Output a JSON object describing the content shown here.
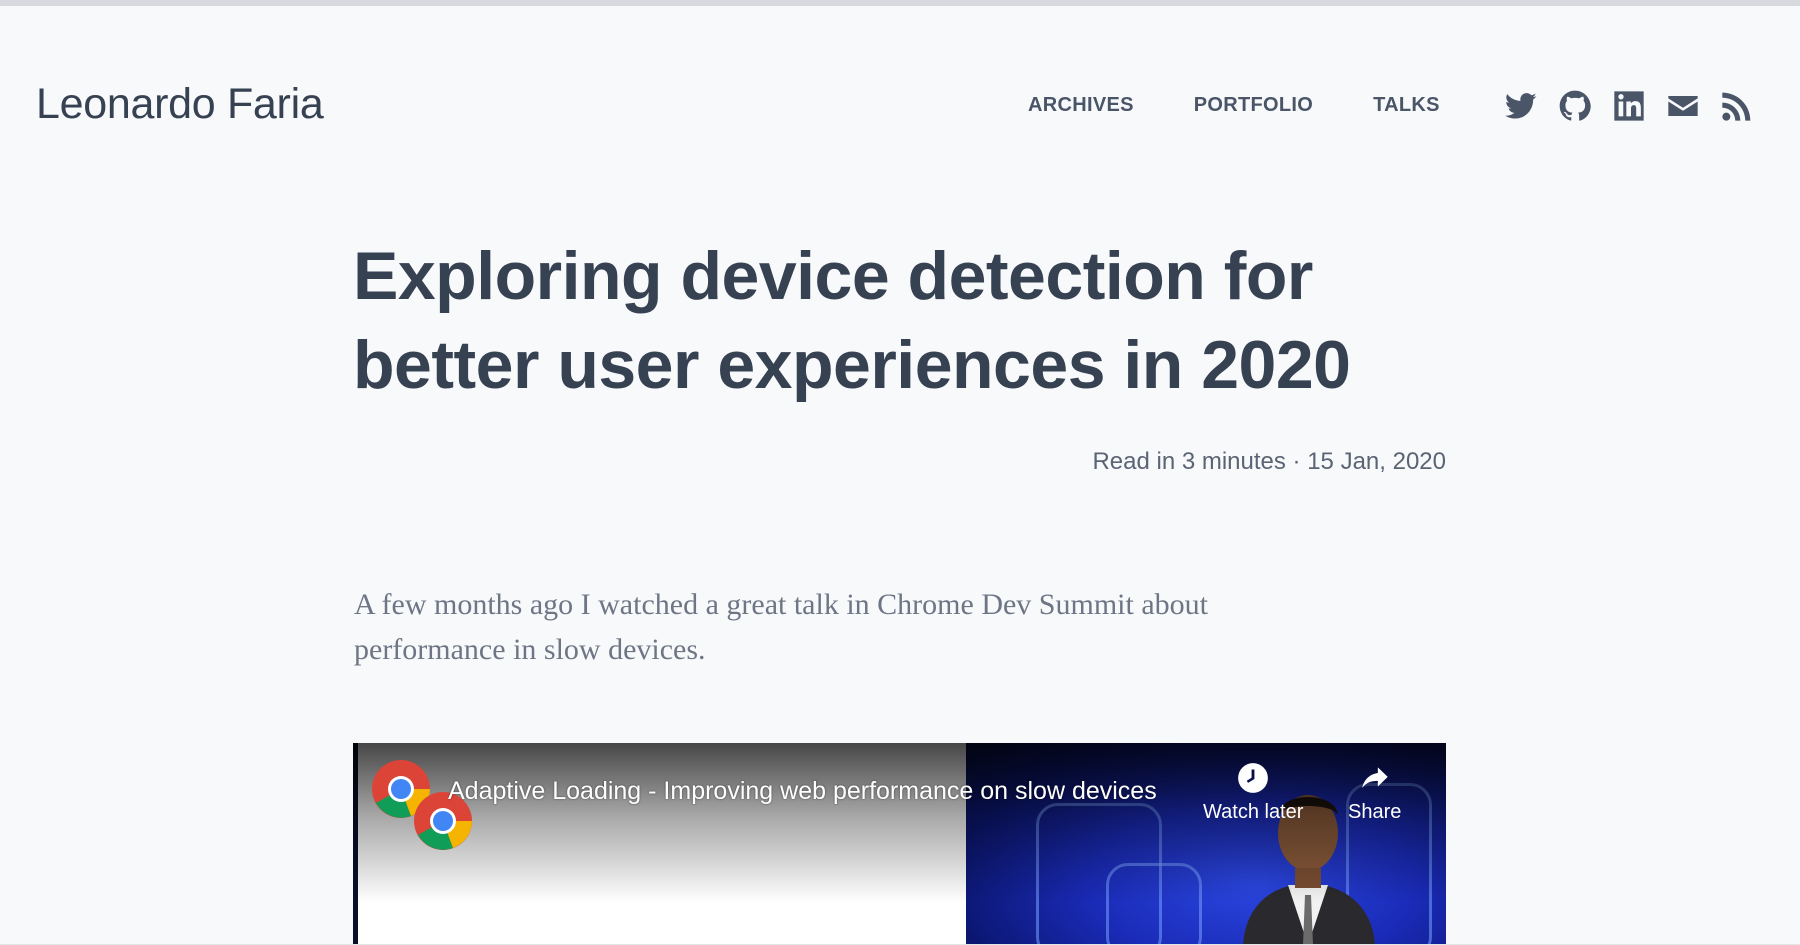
{
  "site": {
    "brand": "Leonardo Faria"
  },
  "nav": {
    "items": [
      {
        "label": "ARCHIVES"
      },
      {
        "label": "PORTFOLIO"
      },
      {
        "label": "TALKS"
      }
    ]
  },
  "social": {
    "icons": [
      "twitter-icon",
      "github-icon",
      "linkedin-icon",
      "email-icon",
      "rss-icon"
    ]
  },
  "post": {
    "title": "Exploring device detection for better user experiences in 2020",
    "meta": "Read in 3 minutes · 15 Jan, 2020",
    "lead": "A few months ago I watched a great talk in Chrome Dev Summit about performance in slow devices."
  },
  "video": {
    "title": "Adaptive Loading - Improving web performance on slow devices",
    "watch_later_label": "Watch later",
    "share_label": "Share"
  },
  "colors": {
    "background": "#f8f9fb",
    "text": "#364152",
    "muted": "#6e7685"
  }
}
